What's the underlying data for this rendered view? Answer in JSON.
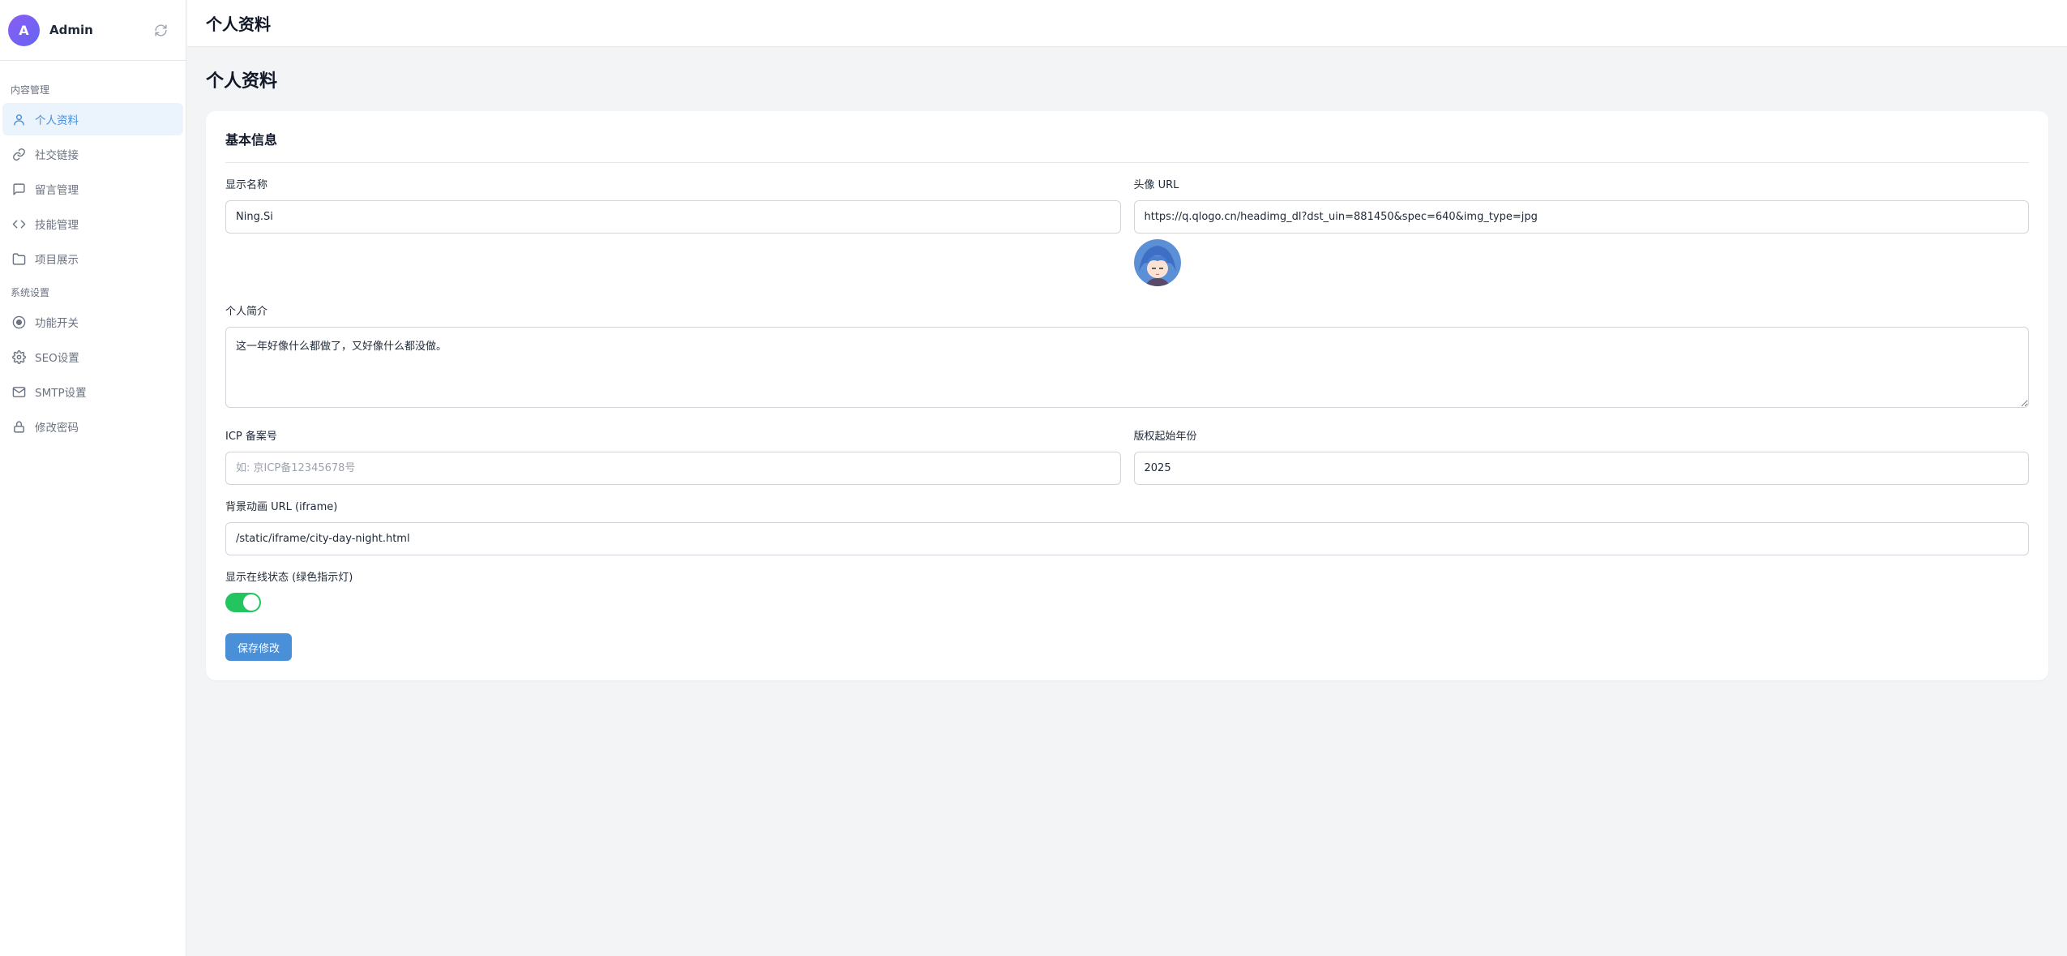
{
  "sidebar": {
    "avatar_letter": "A",
    "user_name": "Admin",
    "sections": [
      {
        "label": "内容管理"
      },
      {
        "label": "系统设置"
      }
    ],
    "items": [
      {
        "label": "个人资料",
        "icon": "user-icon"
      },
      {
        "label": "社交链接",
        "icon": "link-icon"
      },
      {
        "label": "留言管理",
        "icon": "message-icon"
      },
      {
        "label": "技能管理",
        "icon": "code-icon"
      },
      {
        "label": "项目展示",
        "icon": "folder-icon"
      },
      {
        "label": "功能开关",
        "icon": "toggle-circle-icon"
      },
      {
        "label": "SEO设置",
        "icon": "gear-icon"
      },
      {
        "label": "SMTP设置",
        "icon": "mail-icon"
      },
      {
        "label": "修改密码",
        "icon": "lock-icon"
      }
    ]
  },
  "topbar": {
    "title": "个人资料"
  },
  "page": {
    "title": "个人资料"
  },
  "card": {
    "title": "基本信息",
    "display_name": {
      "label": "显示名称",
      "value": "Ning.Si"
    },
    "avatar_url": {
      "label": "头像 URL",
      "value": "https://q.qlogo.cn/headimg_dl?dst_uin=881450&spec=640&img_type=jpg"
    },
    "bio": {
      "label": "个人简介",
      "value": "这一年好像什么都做了，又好像什么都没做。"
    },
    "icp": {
      "label": "ICP 备案号",
      "placeholder": "如: 京ICP备12345678号",
      "value": ""
    },
    "copyright_year": {
      "label": "版权起始年份",
      "value": "2025"
    },
    "bg_url": {
      "label": "背景动画 URL (iframe)",
      "value": "/static/iframe/city-day-night.html"
    },
    "online_status": {
      "label": "显示在线状态 (绿色指示灯)",
      "enabled": true
    },
    "save_label": "保存修改"
  },
  "colors": {
    "accent": "#4a90d9",
    "toggle_on": "#22c55e"
  }
}
